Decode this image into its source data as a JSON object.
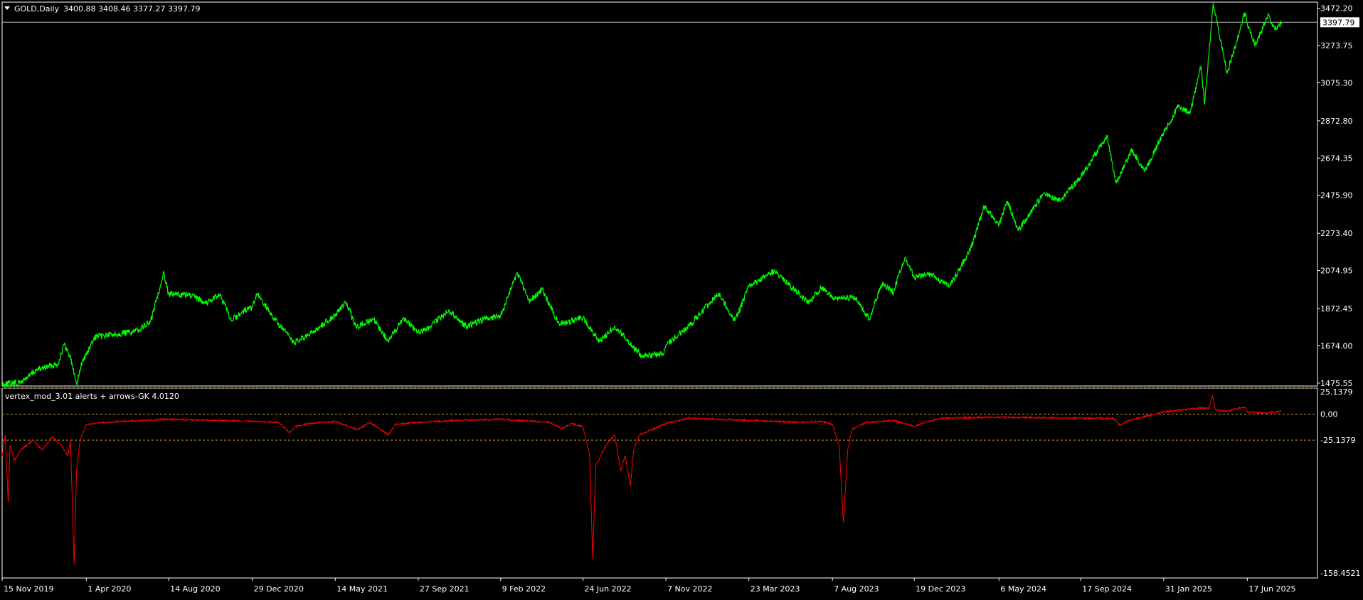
{
  "header": {
    "symbol": "GOLD,Daily",
    "ohlc": "3400.88 3408.46 3377.27 3397.79"
  },
  "colors": {
    "background": "#000000",
    "frame": "#FFFFFF",
    "price_line": "#00FF00",
    "indicator_line": "#FF0000",
    "level_line": "#D4A017",
    "current_price_bg": "#FFFFFF",
    "current_price_text": "#000000"
  },
  "chart_data": [
    {
      "type": "line",
      "panel": "price",
      "title": "GOLD,Daily",
      "current_price": 3397.79,
      "current_price_label": "3397.79",
      "ylim": [
        1460,
        3505
      ],
      "y_ticks": [
        3472.2,
        3273.75,
        3075.3,
        2872.8,
        2674.35,
        2475.9,
        2273.4,
        2074.95,
        1872.45,
        1674.0,
        1475.55
      ],
      "y_tick_labels": [
        "3472.20",
        "3273.75",
        "3075.30",
        "2872.80",
        "2674.35",
        "2475.90",
        "2273.40",
        "2074.95",
        "1872.45",
        "1674.00",
        "1475.55"
      ],
      "x_ticks": [
        "15 Nov 2019",
        "1 Apr 2020",
        "14 Aug 2020",
        "29 Dec 2020",
        "14 May 2021",
        "27 Sep 2021",
        "9 Feb 2022",
        "24 Jun 2022",
        "7 Nov 2022",
        "23 Mar 2023",
        "7 Aug 2023",
        "19 Dec 2023",
        "6 May 2024",
        "17 Sep 2024",
        "31 Jan 2025",
        "17 Jun 2025"
      ],
      "x_tick_dates": [
        "2019-11-15",
        "2020-04-01",
        "2020-08-14",
        "2020-12-29",
        "2021-05-14",
        "2021-09-27",
        "2022-02-09",
        "2022-06-24",
        "2022-11-07",
        "2023-03-23",
        "2023-08-07",
        "2023-12-19",
        "2024-05-06",
        "2024-09-17",
        "2025-01-31",
        "2025-06-17"
      ],
      "series": [
        {
          "values": [
            [
              "2019-11-15",
              1470
            ],
            [
              "2019-12-15",
              1478
            ],
            [
              "2020-01-10",
              1545
            ],
            [
              "2020-02-15",
              1580
            ],
            [
              "2020-02-24",
              1680
            ],
            [
              "2020-03-05",
              1625
            ],
            [
              "2020-03-16",
              1470
            ],
            [
              "2020-03-26",
              1600
            ],
            [
              "2020-04-01",
              1625
            ],
            [
              "2020-04-15",
              1720
            ],
            [
              "2020-05-15",
              1735
            ],
            [
              "2020-06-20",
              1750
            ],
            [
              "2020-07-15",
              1800
            ],
            [
              "2020-08-06",
              2065
            ],
            [
              "2020-08-14",
              1950
            ],
            [
              "2020-09-15",
              1945
            ],
            [
              "2020-10-15",
              1905
            ],
            [
              "2020-11-05",
              1950
            ],
            [
              "2020-11-25",
              1810
            ],
            [
              "2020-12-15",
              1860
            ],
            [
              "2020-12-29",
              1880
            ],
            [
              "2021-01-06",
              1950
            ],
            [
              "2021-02-05",
              1810
            ],
            [
              "2021-03-08",
              1690
            ],
            [
              "2021-04-01",
              1730
            ],
            [
              "2021-05-14",
              1840
            ],
            [
              "2021-06-01",
              1905
            ],
            [
              "2021-06-17",
              1775
            ],
            [
              "2021-07-15",
              1815
            ],
            [
              "2021-08-09",
              1700
            ],
            [
              "2021-09-03",
              1825
            ],
            [
              "2021-09-27",
              1745
            ],
            [
              "2021-10-15",
              1770
            ],
            [
              "2021-11-16",
              1865
            ],
            [
              "2021-12-15",
              1775
            ],
            [
              "2022-01-15",
              1820
            ],
            [
              "2022-02-09",
              1830
            ],
            [
              "2022-03-08",
              2065
            ],
            [
              "2022-03-28",
              1910
            ],
            [
              "2022-04-18",
              1975
            ],
            [
              "2022-05-16",
              1790
            ],
            [
              "2022-06-24",
              1825
            ],
            [
              "2022-07-21",
              1695
            ],
            [
              "2022-08-15",
              1780
            ],
            [
              "2022-09-15",
              1665
            ],
            [
              "2022-09-28",
              1620
            ],
            [
              "2022-11-03",
              1630
            ],
            [
              "2022-11-07",
              1680
            ],
            [
              "2022-12-15",
              1780
            ],
            [
              "2023-02-01",
              1955
            ],
            [
              "2023-02-28",
              1805
            ],
            [
              "2023-03-23",
              1990
            ],
            [
              "2023-05-04",
              2075
            ],
            [
              "2023-06-29",
              1900
            ],
            [
              "2023-07-20",
              1985
            ],
            [
              "2023-08-07",
              1935
            ],
            [
              "2023-09-15",
              1925
            ],
            [
              "2023-10-06",
              1815
            ],
            [
              "2023-10-27",
              2005
            ],
            [
              "2023-11-15",
              1960
            ],
            [
              "2023-12-04",
              2145
            ],
            [
              "2023-12-19",
              2040
            ],
            [
              "2024-01-15",
              2055
            ],
            [
              "2024-02-15",
              1990
            ],
            [
              "2024-03-20",
              2185
            ],
            [
              "2024-04-12",
              2420
            ],
            [
              "2024-05-06",
              2320
            ],
            [
              "2024-05-20",
              2445
            ],
            [
              "2024-06-07",
              2290
            ],
            [
              "2024-07-17",
              2480
            ],
            [
              "2024-08-15",
              2450
            ],
            [
              "2024-09-17",
              2575
            ],
            [
              "2024-10-30",
              2790
            ],
            [
              "2024-11-14",
              2540
            ],
            [
              "2024-12-10",
              2720
            ],
            [
              "2024-12-30",
              2600
            ],
            [
              "2025-01-31",
              2810
            ],
            [
              "2025-02-24",
              2950
            ],
            [
              "2025-03-15",
              2910
            ],
            [
              "2025-04-02",
              3165
            ],
            [
              "2025-04-08",
              2960
            ],
            [
              "2025-04-22",
              3500
            ],
            [
              "2025-05-15",
              3125
            ],
            [
              "2025-06-13",
              3450
            ],
            [
              "2025-06-17",
              3390
            ],
            [
              "2025-06-30",
              3280
            ],
            [
              "2025-07-22",
              3435
            ],
            [
              "2025-08-01",
              3360
            ],
            [
              "2025-08-12",
              3397.79
            ]
          ]
        }
      ]
    },
    {
      "type": "line",
      "panel": "indicator",
      "title": "vertex_mod_3.01 alerts + arrows-GK 4.0120",
      "ylim": [
        -158.4521,
        25.1379
      ],
      "levels": [
        25.1379,
        0,
        -25.1379
      ],
      "y_tick_labels": [
        "25.1379",
        "0.00",
        "-25.1379",
        "-158.4521"
      ],
      "y_ticks": [
        25.1379,
        0,
        -25.1379,
        -158.4521
      ],
      "series": [
        {
          "values": [
            [
              "2019-11-15",
              -40
            ],
            [
              "2019-11-20",
              -20
            ],
            [
              "2019-11-25",
              -85
            ],
            [
              "2019-11-28",
              -30
            ],
            [
              "2019-12-05",
              -45
            ],
            [
              "2019-12-15",
              -35
            ],
            [
              "2020-01-05",
              -25
            ],
            [
              "2020-01-20",
              -35
            ],
            [
              "2020-02-05",
              -22
            ],
            [
              "2020-02-20",
              -30
            ],
            [
              "2020-03-02",
              -40
            ],
            [
              "2020-03-06",
              -25
            ],
            [
              "2020-03-12",
              -145
            ],
            [
              "2020-03-16",
              -55
            ],
            [
              "2020-03-22",
              -25
            ],
            [
              "2020-04-01",
              -10
            ],
            [
              "2020-05-01",
              -8
            ],
            [
              "2020-06-01",
              -7
            ],
            [
              "2020-08-14",
              -5
            ],
            [
              "2020-11-01",
              -6
            ],
            [
              "2021-01-01",
              -7
            ],
            [
              "2021-02-10",
              -8
            ],
            [
              "2021-02-28",
              -18
            ],
            [
              "2021-03-10",
              -12
            ],
            [
              "2021-04-01",
              -9
            ],
            [
              "2021-05-14",
              -7
            ],
            [
              "2021-06-20",
              -15
            ],
            [
              "2021-07-10",
              -8
            ],
            [
              "2021-08-09",
              -20
            ],
            [
              "2021-08-20",
              -10
            ],
            [
              "2021-09-27",
              -8
            ],
            [
              "2021-12-01",
              -6
            ],
            [
              "2022-02-09",
              -5
            ],
            [
              "2022-05-01",
              -8
            ],
            [
              "2022-05-20",
              -14
            ],
            [
              "2022-06-05",
              -9
            ],
            [
              "2022-06-24",
              -12
            ],
            [
              "2022-07-05",
              -40
            ],
            [
              "2022-07-10",
              -140
            ],
            [
              "2022-07-15",
              -50
            ],
            [
              "2022-08-01",
              -30
            ],
            [
              "2022-08-15",
              -20
            ],
            [
              "2022-08-25",
              -55
            ],
            [
              "2022-09-01",
              -40
            ],
            [
              "2022-09-10",
              -70
            ],
            [
              "2022-09-15",
              -35
            ],
            [
              "2022-09-25",
              -20
            ],
            [
              "2022-10-15",
              -15
            ],
            [
              "2022-11-07",
              -9
            ],
            [
              "2022-12-15",
              -4
            ],
            [
              "2023-03-23",
              -6
            ],
            [
              "2023-06-15",
              -8
            ],
            [
              "2023-07-20",
              -7
            ],
            [
              "2023-08-07",
              -10
            ],
            [
              "2023-08-18",
              -30
            ],
            [
              "2023-08-25",
              -105
            ],
            [
              "2023-09-01",
              -35
            ],
            [
              "2023-09-08",
              -15
            ],
            [
              "2023-10-01",
              -8
            ],
            [
              "2023-11-15",
              -6
            ],
            [
              "2023-12-19",
              -12
            ],
            [
              "2024-01-05",
              -8
            ],
            [
              "2024-02-01",
              -4
            ],
            [
              "2024-05-06",
              -3
            ],
            [
              "2024-09-17",
              -4
            ],
            [
              "2024-11-10",
              -4
            ],
            [
              "2024-11-20",
              -11
            ],
            [
              "2024-12-05",
              -6
            ],
            [
              "2025-01-31",
              2
            ],
            [
              "2025-03-15",
              5
            ],
            [
              "2025-04-15",
              6
            ],
            [
              "2025-04-21",
              18
            ],
            [
              "2025-04-26",
              4
            ],
            [
              "2025-05-15",
              3
            ],
            [
              "2025-06-13",
              7
            ],
            [
              "2025-06-17",
              2
            ],
            [
              "2025-07-15",
              1
            ],
            [
              "2025-08-12",
              3
            ]
          ]
        }
      ]
    }
  ]
}
